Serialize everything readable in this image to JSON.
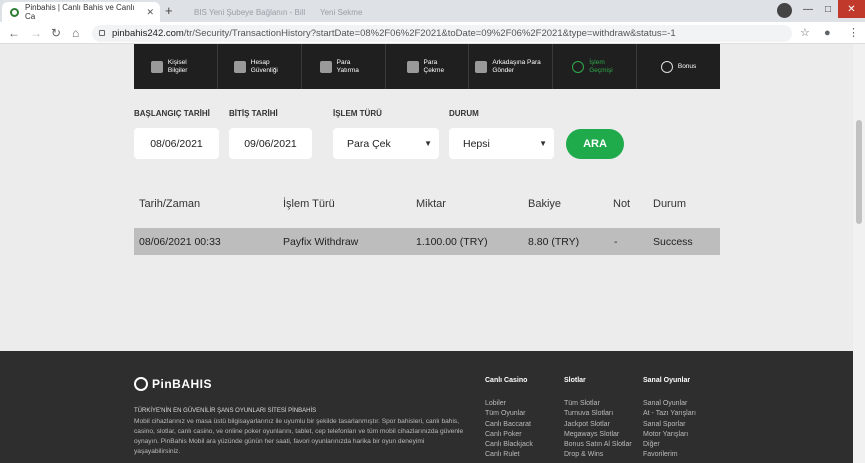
{
  "browser": {
    "tabs": [
      {
        "title": "Pinbahis | Canlı Bahis ve Canlı Ca"
      },
      {
        "title": "BIS Yeni Şubeye Bağlanın - Bill"
      },
      {
        "title": "Yeni Sekme"
      }
    ],
    "url_host": "pinbahis242.com",
    "url_path": "/tr/Security/TransactionHistory?startDate=08%2F06%2F2021&toDate=09%2F06%2F2021&type=withdraw&status=-1"
  },
  "menu": [
    {
      "label": "Kişisel Bilgiler",
      "icon": "user-icon"
    },
    {
      "label": "Hesap Güvenliği",
      "icon": "shield-icon"
    },
    {
      "label": "Para Yatırma",
      "icon": "deposit-icon"
    },
    {
      "label": "Para Çekme",
      "icon": "withdraw-icon"
    },
    {
      "label": "Arkadaşına Para Gönder",
      "icon": "transfer-icon"
    },
    {
      "label": "İşlem Geçmişi",
      "icon": "history-icon"
    },
    {
      "label": "Bonus",
      "icon": "bonus-icon"
    }
  ],
  "filters": {
    "start_label": "BAŞLANGIÇ TARİHİ",
    "start_value": "08/06/2021",
    "end_label": "BİTİŞ TARİHİ",
    "end_value": "09/06/2021",
    "type_label": "İŞLEM TÜRÜ",
    "type_value": "Para Çek",
    "status_label": "DURUM",
    "status_value": "Hepsi",
    "search_label": "ARA"
  },
  "table": {
    "headers": [
      "Tarih/Zaman",
      "İşlem Türü",
      "Miktar",
      "Bakiye",
      "Not",
      "Durum"
    ],
    "rows": [
      [
        "08/06/2021 00:33",
        "Payfix Withdraw",
        "1.100.00 (TRY)",
        "8.80 (TRY)",
        "-",
        "Success"
      ]
    ]
  },
  "footer": {
    "logo": "PinBAHIS",
    "title": "TÜRKİYE'NİN EN GÜVENİLİR ŞANS OYUNLARI SİTESİ PİNBAHİS",
    "desc": "Mobil cihazlarınız ve masa üstü bilgisayarlarınız ile uyumlu bir şekilde tasarlanmıştır. Spor bahisleri, canlı bahis, casino, slotlar, canlı casino, ve online poker oyunlarını, tablet, cep telefonları ve tüm mobil cihazlarınızda güvenle oynayın. PinBahis Mobil ara yüzünde günün her saati, favori oyunlarınızda harika bir oyun deneyimi yaşayabilirsiniz.",
    "columns": [
      {
        "title": "Canlı Casino",
        "items": [
          "Lobiler",
          "Tüm Oyunlar",
          "Canlı Baccarat",
          "Canlı Poker",
          "Canlı Blackjack",
          "Canlı Rulet"
        ]
      },
      {
        "title": "Slotlar",
        "items": [
          "Tüm Slotlar",
          "Turnuva Slotları",
          "Jackpot Slotlar",
          "Megaways Slotlar",
          "Bonus Satın Al Slotlar",
          "Drop & Wins"
        ]
      },
      {
        "title": "Sanal Oyunlar",
        "items": [
          "Sanal Oyunlar",
          "At - Tazı Yarışları",
          "Sanal Sporlar",
          "Motor Yarışları",
          "Diğer",
          "Favorilerim"
        ]
      }
    ]
  },
  "colors": {
    "accent": "#1faa4b",
    "menu_bg": "#1f1f1f",
    "footer_bg": "#2e2e2e"
  }
}
